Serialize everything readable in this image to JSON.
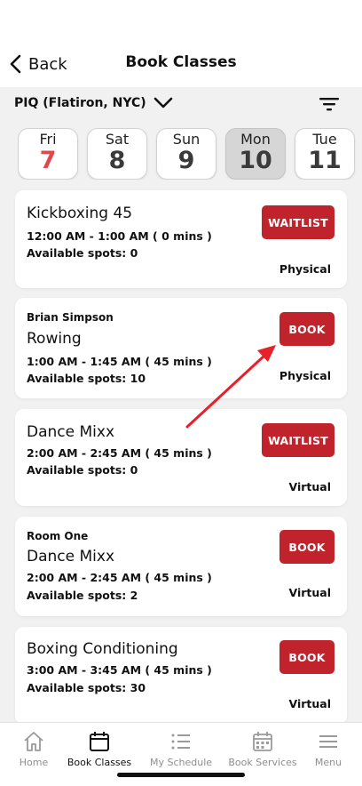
{
  "header": {
    "back_label": "Back",
    "title": "Book Classes"
  },
  "location": {
    "label": "PIQ (Flatiron, NYC)"
  },
  "dates": [
    {
      "day": "Fri",
      "num": "7"
    },
    {
      "day": "Sat",
      "num": "8"
    },
    {
      "day": "Sun",
      "num": "9"
    },
    {
      "day": "Mon",
      "num": "10"
    },
    {
      "day": "Tue",
      "num": "11"
    }
  ],
  "classes": [
    {
      "instructor": "",
      "name": "Kickboxing 45",
      "time": "12:00 AM - 1:00 AM ( 0 mins )",
      "spots": "Available spots: 0",
      "type": "Physical",
      "button": "WAITLIST"
    },
    {
      "instructor": "Brian Simpson",
      "name": "Rowing",
      "time": "1:00 AM - 1:45 AM ( 45 mins )",
      "spots": "Available spots: 10",
      "type": "Physical",
      "button": "BOOK"
    },
    {
      "instructor": "",
      "name": "Dance Mixx",
      "time": "2:00 AM - 2:45 AM ( 45 mins )",
      "spots": "Available spots: 0",
      "type": "Virtual",
      "button": "WAITLIST"
    },
    {
      "instructor": "Room One",
      "name": "Dance Mixx",
      "time": "2:00 AM - 2:45 AM ( 45 mins )",
      "spots": "Available spots: 2",
      "type": "Virtual",
      "button": "BOOK"
    },
    {
      "instructor": "",
      "name": "Boxing Conditioning",
      "time": "3:00 AM - 3:45 AM ( 45 mins )",
      "spots": "Available spots: 30",
      "type": "Virtual",
      "button": "BOOK"
    }
  ],
  "tabs": [
    {
      "label": "Home",
      "icon": "home-icon"
    },
    {
      "label": "Book Classes",
      "icon": "calendar-icon"
    },
    {
      "label": "My Schedule",
      "icon": "list-icon"
    },
    {
      "label": "Book Services",
      "icon": "calendar-grid-icon"
    },
    {
      "label": "Menu",
      "icon": "menu-icon"
    }
  ],
  "colors": {
    "accent": "#c1232c",
    "today": "#e0484f",
    "selected_day": "#d6d6d6",
    "annotation_arrow": "#e8202a"
  }
}
